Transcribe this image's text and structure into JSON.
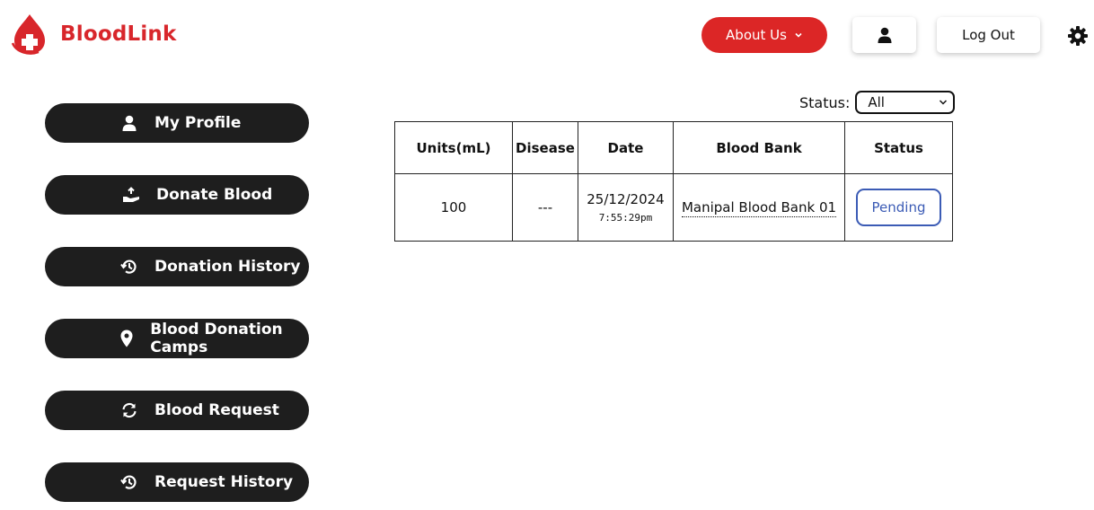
{
  "brand": {
    "name": "BloodLink",
    "color": "#d8262b"
  },
  "header": {
    "about_label": "About Us",
    "logout_label": "Log Out"
  },
  "sidebar": {
    "items": [
      {
        "label": "My Profile",
        "icon": "user-icon"
      },
      {
        "label": "Donate Blood",
        "icon": "donate-hand-icon"
      },
      {
        "label": "Donation History",
        "icon": "history-icon"
      },
      {
        "label": "Blood Donation Camps",
        "icon": "map-pin-icon"
      },
      {
        "label": "Blood Request",
        "icon": "refresh-icon"
      },
      {
        "label": "Request History",
        "icon": "history-icon"
      }
    ]
  },
  "filter": {
    "label": "Status:",
    "selected": "All"
  },
  "table": {
    "headers": [
      "Units(mL)",
      "Disease",
      "Date",
      "Blood Bank",
      "Status"
    ],
    "rows": [
      {
        "units": "100",
        "disease": "---",
        "date": "25/12/2024",
        "time": "7:55:29pm",
        "bank": "Manipal Blood Bank 01",
        "status": "Pending"
      }
    ]
  },
  "colors": {
    "accent": "#dc2626",
    "sidebar_bg": "#1e1e1e",
    "pending": "#3b5bb5"
  }
}
